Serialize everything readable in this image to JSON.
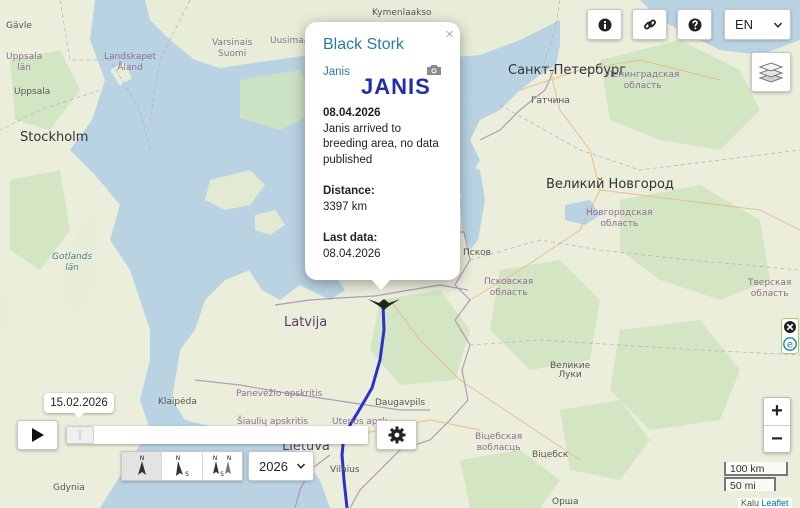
{
  "map": {
    "labels": {
      "kymenlaakso": "Kymenlaakso",
      "gavle": "Gävle",
      "uppsala_lan": "Uppsala\nlän",
      "landskapet_aland": "Landskapet\nÅland",
      "varsinais_suomi": "Varsinais\nSuomi",
      "uusimaa": "Uusimaa",
      "uppsala": "Uppsala",
      "stockholm": "Stockholm",
      "saint_petersburg": "Санкт-Петербург",
      "leningrad_oblast": "Ленинградская\nобласть",
      "gatchina": "Гатчина",
      "veliky_novgorod": "Великий Новгород",
      "novgorod_oblast": "Новгородская\nобласть",
      "gotlands_lan": "Gotlands\nlän",
      "pskov": "Псков",
      "pskov_oblast": "Псковская\nобласть",
      "tver_oblast": "Тверская\nобласть",
      "latvija": "Latvija",
      "velikie_luki": "Великие\nЛуки",
      "klaipeda": "Klaipėda",
      "daugavpils": "Daugavpils",
      "siauliu": "Šiaulių apskritis",
      "panevezio": "Panevėžio apskritis",
      "utenos": "Utenos apsk",
      "lietuva": "Lietuva",
      "vitebsk_oblast": "Віцебская\nвобласць",
      "vitebsk": "Віцебск",
      "vilnius": "Vilnius",
      "gdynia": "Gdynia",
      "orsha": "Орша"
    }
  },
  "popup": {
    "title": "Black Stork",
    "bird_name": "Janis",
    "logo_text": "JANIS",
    "close": "×",
    "date": "08.04.2026",
    "status": "Janis arrived to breeding area, no data published",
    "distance_label": "Distance:",
    "distance_value": "3397 km",
    "last_data_label": "Last data:",
    "last_data_value": "08.04.2026"
  },
  "controls": {
    "info_icon": "info-circle-icon",
    "link_icon": "link-icon",
    "help_icon": "question-circle-icon",
    "language": "EN",
    "layers_icon": "layers-icon",
    "play_icon": "play-icon",
    "settings_icon": "gear-icon",
    "timeline_date": "15.02.2026",
    "timeline_progress": 0.0,
    "year": "2026",
    "zoom_in": "+",
    "zoom_out": "−"
  },
  "scale": {
    "km": "100 km",
    "mi": "50 mi"
  },
  "attribution": {
    "prefix": "Kalu",
    "leaflet": "Leaflet"
  },
  "colors": {
    "track": "#2b2fd0",
    "water": "#b9d3e3",
    "land": "#eef0e3",
    "forest": "#cfe4bf",
    "title": "#2a7aa8"
  }
}
